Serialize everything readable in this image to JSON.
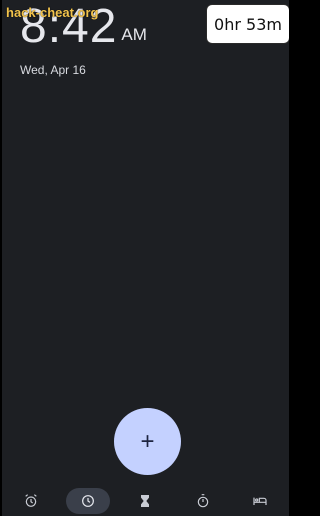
{
  "watermark": "hack-cheat.org",
  "clock": {
    "time": "8:42",
    "ampm": "AM",
    "date": "Wed, Apr 16"
  },
  "overlay": {
    "label": "0hr 53m"
  },
  "fab": {
    "label": "+"
  },
  "nav": {
    "items": [
      {
        "icon": "alarm-icon",
        "active": false
      },
      {
        "icon": "clock-icon",
        "active": true
      },
      {
        "icon": "hourglass-icon",
        "active": false
      },
      {
        "icon": "stopwatch-icon",
        "active": false
      },
      {
        "icon": "bed-icon",
        "active": false
      }
    ]
  },
  "colors": {
    "background": "#1d1f23",
    "accent": "#c4d1ff",
    "active_pill": "#3a3f4a",
    "text": "#e6e7ec"
  }
}
